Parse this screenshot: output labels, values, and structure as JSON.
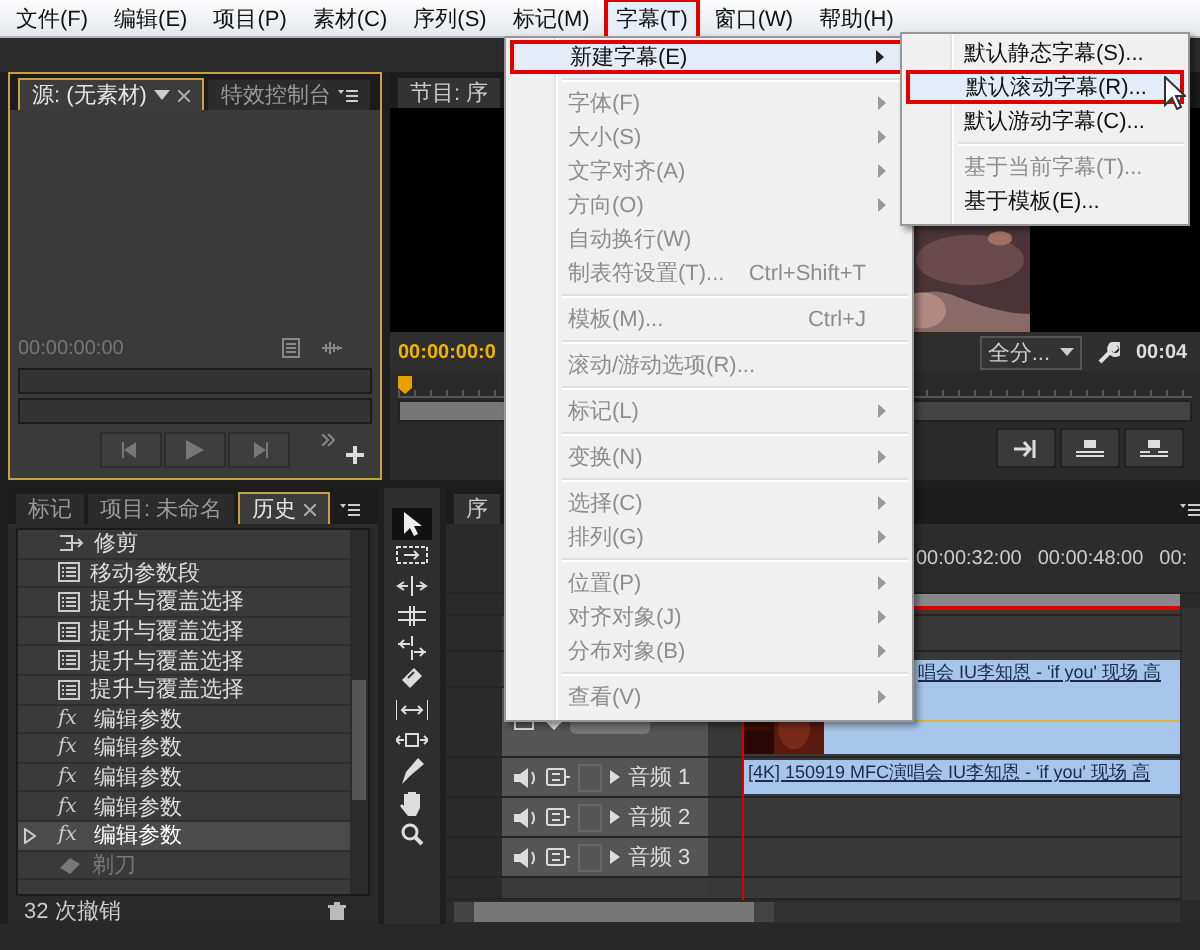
{
  "menubar": [
    {
      "label": "文件(F)",
      "selected": false
    },
    {
      "label": "编辑(E)",
      "selected": false
    },
    {
      "label": "项目(P)",
      "selected": false
    },
    {
      "label": "素材(C)",
      "selected": false
    },
    {
      "label": "序列(S)",
      "selected": false
    },
    {
      "label": "标记(M)",
      "selected": false
    },
    {
      "label": "字幕(T)",
      "selected": true
    },
    {
      "label": "窗口(W)",
      "selected": false
    },
    {
      "label": "帮助(H)",
      "selected": false
    }
  ],
  "title_menu": {
    "items": [
      {
        "kind": "item",
        "label": "新建字幕(E)",
        "submenu": true,
        "disabled": false,
        "selected": true
      },
      {
        "kind": "separator"
      },
      {
        "kind": "item",
        "label": "字体(F)",
        "submenu": true,
        "disabled": true,
        "selected": false
      },
      {
        "kind": "item",
        "label": "大小(S)",
        "submenu": true,
        "disabled": true,
        "selected": false
      },
      {
        "kind": "item",
        "label": "文字对齐(A)",
        "submenu": true,
        "disabled": true,
        "selected": false
      },
      {
        "kind": "item",
        "label": "方向(O)",
        "submenu": true,
        "disabled": true,
        "selected": false
      },
      {
        "kind": "item",
        "label": "自动换行(W)",
        "submenu": false,
        "disabled": true,
        "selected": false
      },
      {
        "kind": "item",
        "label": "制表符设置(T)...",
        "shortcut": "Ctrl+Shift+T",
        "submenu": false,
        "disabled": true,
        "selected": false
      },
      {
        "kind": "separator"
      },
      {
        "kind": "item",
        "label": "模板(M)...",
        "shortcut": "Ctrl+J",
        "submenu": false,
        "disabled": true,
        "selected": false
      },
      {
        "kind": "separator"
      },
      {
        "kind": "item",
        "label": "滚动/游动选项(R)...",
        "submenu": false,
        "disabled": true,
        "selected": false
      },
      {
        "kind": "separator"
      },
      {
        "kind": "item",
        "label": "标记(L)",
        "submenu": true,
        "disabled": true,
        "selected": false
      },
      {
        "kind": "separator"
      },
      {
        "kind": "item",
        "label": "变换(N)",
        "submenu": true,
        "disabled": true,
        "selected": false
      },
      {
        "kind": "separator"
      },
      {
        "kind": "item",
        "label": "选择(C)",
        "submenu": true,
        "disabled": true,
        "selected": false
      },
      {
        "kind": "item",
        "label": "排列(G)",
        "submenu": true,
        "disabled": true,
        "selected": false
      },
      {
        "kind": "separator"
      },
      {
        "kind": "item",
        "label": "位置(P)",
        "submenu": true,
        "disabled": true,
        "selected": false
      },
      {
        "kind": "item",
        "label": "对齐对象(J)",
        "submenu": true,
        "disabled": true,
        "selected": false
      },
      {
        "kind": "item",
        "label": "分布对象(B)",
        "submenu": true,
        "disabled": true,
        "selected": false
      },
      {
        "kind": "separator"
      },
      {
        "kind": "item",
        "label": "查看(V)",
        "submenu": true,
        "disabled": true,
        "selected": false
      }
    ]
  },
  "submenu": {
    "items": [
      {
        "kind": "item",
        "label": "默认静态字幕(S)...",
        "disabled": false,
        "selected": false
      },
      {
        "kind": "item",
        "label": "默认滚动字幕(R)...",
        "disabled": false,
        "selected": true
      },
      {
        "kind": "item",
        "label": "默认游动字幕(C)...",
        "disabled": false,
        "selected": false
      },
      {
        "kind": "separator"
      },
      {
        "kind": "item",
        "label": "基于当前字幕(T)...",
        "disabled": true,
        "selected": false
      },
      {
        "kind": "item",
        "label": "基于模板(E)...",
        "disabled": false,
        "selected": false
      }
    ]
  },
  "source_panel": {
    "tabs": [
      {
        "label": "源: (无素材)",
        "selected": true
      },
      {
        "label": "特效控制台",
        "selected": false
      }
    ],
    "timecode": "00:00:00:00"
  },
  "program_panel": {
    "tab": "节目: 序",
    "timecode": "00:00:00:0",
    "zoom": "全分...",
    "duration": "00:04"
  },
  "project_panel": {
    "tabs": [
      {
        "label": "标记",
        "selected": false
      },
      {
        "label": "项目: 未命名",
        "selected": false
      },
      {
        "label": "历史",
        "selected": true
      }
    ],
    "history": [
      {
        "kind": "trim",
        "label": "修剪",
        "selected": false,
        "disabled": false
      },
      {
        "kind": "list",
        "label": "移动参数段",
        "selected": false,
        "disabled": false
      },
      {
        "kind": "list",
        "label": "提升与覆盖选择",
        "selected": false,
        "disabled": false
      },
      {
        "kind": "list",
        "label": "提升与覆盖选择",
        "selected": false,
        "disabled": false
      },
      {
        "kind": "list",
        "label": "提升与覆盖选择",
        "selected": false,
        "disabled": false
      },
      {
        "kind": "list",
        "label": "提升与覆盖选择",
        "selected": false,
        "disabled": false
      },
      {
        "kind": "fx",
        "glyph": "fx",
        "label": "编辑参数",
        "selected": false,
        "disabled": false
      },
      {
        "kind": "fx",
        "glyph": "fx",
        "label": "编辑参数",
        "selected": false,
        "disabled": false
      },
      {
        "kind": "fx",
        "glyph": "fx",
        "label": "编辑参数",
        "selected": false,
        "disabled": false
      },
      {
        "kind": "fx",
        "glyph": "fx",
        "label": "编辑参数",
        "selected": false,
        "disabled": false
      },
      {
        "kind": "fx",
        "glyph": "fx",
        "label": "编辑参数",
        "selected": true,
        "disabled": false
      },
      {
        "kind": "razor",
        "label": "剃刀",
        "selected": false,
        "disabled": true
      }
    ],
    "undo_count": "32 次撤销"
  },
  "timeline": {
    "tab": "序",
    "ruler": [
      "00:00:32:00",
      "00:00:48:00",
      "00:"
    ],
    "video_clip": "唱会 IU李知恩 - 'if you' 现场 高",
    "audio_clip": "[4K] 150919 MFC演唱会 IU李知恩 - 'if you' 现场 高",
    "audio_tracks": [
      "音频 1",
      "音频 2",
      "音频 3"
    ]
  }
}
